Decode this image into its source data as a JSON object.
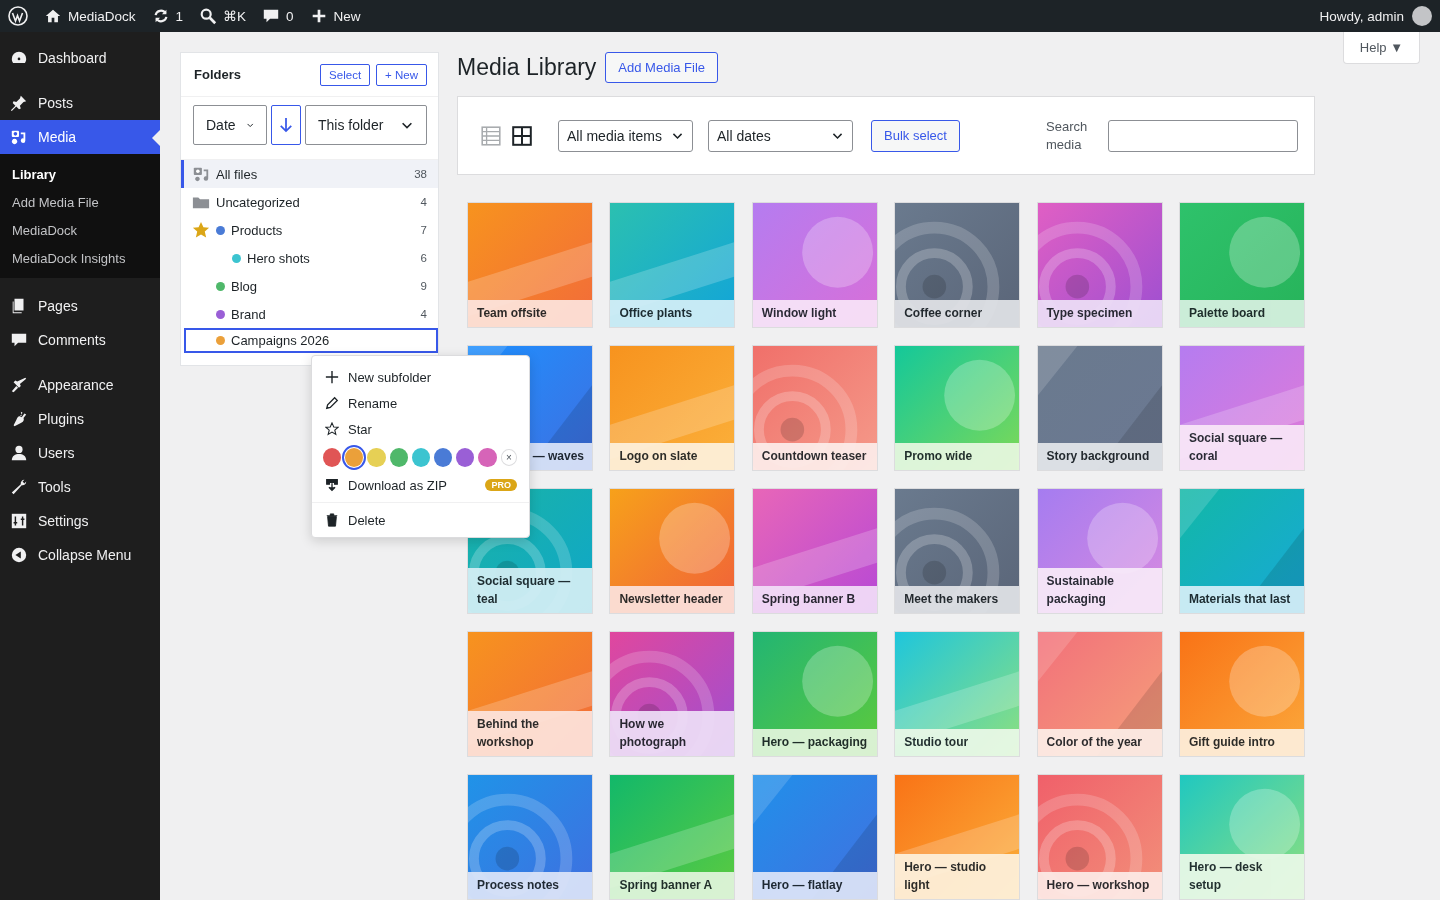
{
  "admin_bar": {
    "site": "MediaDock",
    "updates": "1",
    "search_shortcut": "⌘K",
    "comments": "0",
    "new": "New",
    "greeting": "Howdy, admin"
  },
  "sidebar": {
    "items": [
      {
        "label": "Dashboard",
        "selected": false
      },
      {
        "label": "Posts",
        "selected": false
      },
      {
        "label": "Media",
        "selected": true,
        "children": [
          {
            "label": "Library",
            "selected": true
          },
          {
            "label": "Add Media File",
            "selected": false
          },
          {
            "label": "MediaDock",
            "selected": false
          },
          {
            "label": "MediaDock Insights",
            "selected": false
          }
        ]
      },
      {
        "label": "Pages",
        "selected": false
      },
      {
        "label": "Comments",
        "selected": false
      },
      {
        "label": "Appearance",
        "selected": false
      },
      {
        "label": "Plugins",
        "selected": false
      },
      {
        "label": "Users",
        "selected": false
      },
      {
        "label": "Tools",
        "selected": false
      },
      {
        "label": "Settings",
        "selected": false
      },
      {
        "label": "Collapse Menu",
        "selected": false
      }
    ]
  },
  "folders": {
    "title": "Folders",
    "buttons": [
      "Select",
      "+ New"
    ],
    "sort": "Date",
    "scope": "This folder",
    "tree": [
      {
        "kind": "all",
        "label": "All files",
        "count": "38",
        "selected": true,
        "focused": false,
        "starred": false
      },
      {
        "kind": "uncategorized",
        "label": "Uncategorized",
        "count": "4",
        "selected": false,
        "focused": false,
        "starred": false
      },
      {
        "kind": "folder",
        "label": "Products",
        "count": "7",
        "color": "#4a7bd6",
        "selected": false,
        "focused": false,
        "starred": true,
        "children": [
          {
            "kind": "folder",
            "label": "Hero shots",
            "count": "6",
            "color": "#3cc4d0",
            "selected": false,
            "focused": false,
            "starred": false
          }
        ]
      },
      {
        "kind": "folder",
        "label": "Blog",
        "count": "9",
        "color": "#4fb86a",
        "selected": false,
        "focused": false,
        "starred": false
      },
      {
        "kind": "folder",
        "label": "Brand",
        "count": "4",
        "color": "#9a5fd6",
        "selected": false,
        "focused": false,
        "starred": false
      },
      {
        "kind": "folder",
        "label": "Campaigns 2026",
        "color": "#eba03a",
        "selected": false,
        "focused": true,
        "starred": false
      }
    ]
  },
  "context_menu": {
    "items": [
      {
        "kind": "action",
        "label": "New subfolder"
      },
      {
        "kind": "action",
        "label": "Rename"
      },
      {
        "kind": "action",
        "label": "Star"
      },
      {
        "kind": "colors",
        "colors": [
          {
            "color": "#e05555",
            "selected": false
          },
          {
            "color": "#eba03a",
            "selected": true
          },
          {
            "color": "#e6d055",
            "selected": false
          },
          {
            "color": "#4fb86a",
            "selected": false
          },
          {
            "color": "#3cc4d0",
            "selected": false
          },
          {
            "color": "#4a7bd6",
            "selected": false
          },
          {
            "color": "#9a5fd6",
            "selected": false
          },
          {
            "color": "#d664b8",
            "selected": false
          }
        ],
        "clear": "×"
      },
      {
        "kind": "action",
        "label": "Download as ZIP",
        "badge": "PRO"
      },
      {
        "kind": "divider"
      },
      {
        "kind": "action",
        "label": "Delete"
      }
    ]
  },
  "page": {
    "title": "Media Library",
    "add_button": "Add Media File",
    "help": "Help ▼"
  },
  "toolbar": {
    "list_view_selected": false,
    "grid_view_selected": true,
    "filter": "All media items",
    "dates": "All dates",
    "bulk": "Bulk select",
    "search_label": "Search media"
  },
  "tiles": [
    {
      "caption": "Team offsite"
    },
    {
      "caption": "Office plants"
    },
    {
      "caption": "Window light"
    },
    {
      "caption": "Coffee corner"
    },
    {
      "caption": "Type specimen"
    },
    {
      "caption": "Palette board"
    },
    {
      "caption": "— waves",
      "kind": "partly-covered"
    },
    {
      "caption": "Logo on slate"
    },
    {
      "caption": "Countdown teaser"
    },
    {
      "caption": "Promo wide"
    },
    {
      "caption": "Story background"
    },
    {
      "caption": "Social square — coral"
    },
    {
      "caption": "Social square — teal"
    },
    {
      "caption": "Newsletter header"
    },
    {
      "caption": "Spring banner B"
    },
    {
      "caption": "Meet the makers"
    },
    {
      "caption": "Sustainable packaging"
    },
    {
      "caption": "Materials that last"
    },
    {
      "caption": "Behind the workshop"
    },
    {
      "caption": "How we photograph"
    },
    {
      "caption": "Hero — packaging"
    },
    {
      "caption": "Studio tour"
    },
    {
      "caption": "Color of the year"
    },
    {
      "caption": "Gift guide intro"
    },
    {
      "caption": "Process notes"
    },
    {
      "caption": "Spring banner A"
    },
    {
      "caption": "Hero — flatlay"
    },
    {
      "caption": "Hero — studio light"
    },
    {
      "caption": "Hero — workshop"
    },
    {
      "caption": "Hero — desk setup"
    }
  ]
}
